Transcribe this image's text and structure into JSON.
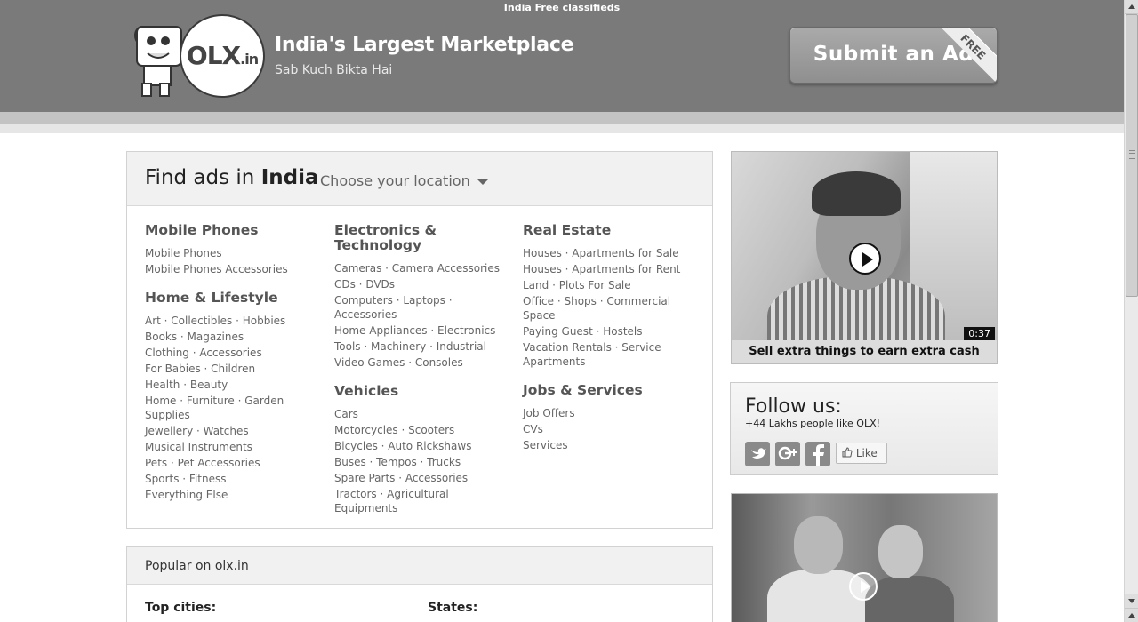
{
  "header": {
    "top_text": "India Free classifieds",
    "logo_text": "OLX",
    "logo_suffix": ".in",
    "title": "India's Largest Marketplace",
    "subtitle": "Sab Kuch Bikta Hai",
    "submit_label": "Submit an Ad",
    "ribbon": "FREE"
  },
  "find": {
    "title_prefix": "Find ads in",
    "title_place": "India",
    "location_label": "Choose your location"
  },
  "columns": [
    [
      {
        "title": "Mobile Phones",
        "items": [
          "Mobile Phones",
          "Mobile Phones Accessories"
        ]
      },
      {
        "title": "Home & Lifestyle",
        "items": [
          "Art · Collectibles · Hobbies",
          "Books · Magazines",
          "Clothing · Accessories",
          "For Babies · Children",
          "Health · Beauty",
          "Home · Furniture · Garden Supplies",
          "Jewellery · Watches",
          "Musical Instruments",
          "Pets · Pet Accessories",
          "Sports · Fitness",
          "Everything Else"
        ]
      }
    ],
    [
      {
        "title": "Electronics & Technology",
        "items": [
          "Cameras · Camera Accessories",
          "CDs · DVDs",
          "Computers · Laptops · Accessories",
          "Home Appliances · Electronics",
          "Tools · Machinery · Industrial",
          "Video Games · Consoles"
        ]
      },
      {
        "title": "Vehicles",
        "items": [
          "Cars",
          "Motorcycles · Scooters",
          "Bicycles · Auto Rickshaws",
          "Buses · Tempos · Trucks",
          "Spare Parts · Accessories",
          "Tractors · Agricultural Equipments"
        ]
      }
    ],
    [
      {
        "title": "Real Estate",
        "items": [
          "Houses · Apartments for Sale",
          "Houses · Apartments for Rent",
          "Land · Plots For Sale",
          "Office · Shops · Commercial Space",
          "Paying Guest · Hostels",
          "Vacation Rentals · Service Apartments"
        ]
      },
      {
        "title": "Jobs & Services",
        "items": [
          "Job Offers",
          "CVs",
          "Services"
        ]
      }
    ]
  ],
  "popular": {
    "title": "Popular on olx.in",
    "top_cities": "Top cities:",
    "states": "States:"
  },
  "video": {
    "duration": "0:37",
    "caption": "Sell extra things to earn extra cash"
  },
  "follow": {
    "title": "Follow us:",
    "subtitle": "+44 Lakhs people like OLX!",
    "like_label": "Like",
    "icons": [
      "twitter-icon",
      "google-plus-icon",
      "facebook-icon"
    ]
  }
}
